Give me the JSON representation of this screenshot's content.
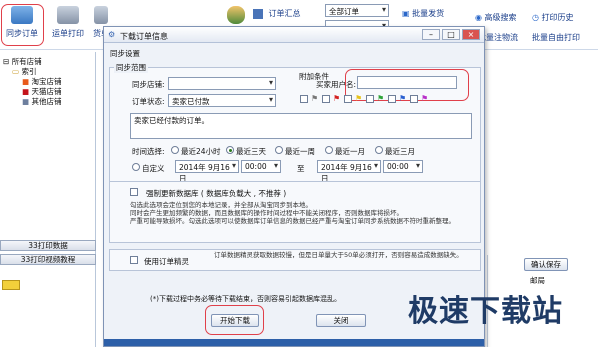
{
  "toolbar": {
    "sync_orders": "同步订单",
    "ship_print": "运单打印",
    "goods": "货单",
    "order_summary": "订单汇总",
    "filter_select": "全部订单",
    "batch_ship": "批量发货",
    "batch_mark": "批量注物流",
    "advanced_search": "高级搜索",
    "print_history": "打印历史",
    "batch_custom_print": "批量自由打印"
  },
  "tree": {
    "all_shops": "所有店铺",
    "index": "索引",
    "taobao": "淘宝店铺",
    "tmall": "天猫店铺",
    "other": "其他店铺"
  },
  "left_buttons": {
    "print_sync": "33打印数据",
    "print_video": "33打印视频教程"
  },
  "dialog": {
    "title": "下载订单信息",
    "sync_settings": "同步设置",
    "sync_range": "同步范围",
    "sync_shop_label": "同步店铺:",
    "order_status_label": "订单状态:",
    "order_status_value": "卖家已付款",
    "extra_cond": "附加条件",
    "buyer_name_label": "买家用户名:",
    "buyer_name_value": "",
    "status_text": "卖家已经付款的订单。",
    "time_label": "时间选择:",
    "time_options": [
      "最近24小时",
      "最近三天",
      "最近一周",
      "最近一月",
      "最近三月"
    ],
    "time_selected_index": 1,
    "custom": "自定义",
    "date_from": "2014年 9月16日",
    "time_from": "00:00",
    "to": "至",
    "date_to": "2014年 9月16日",
    "time_to": "00:00",
    "force_update": "强制更新数据库 ( 数据库负载大 , 不推荐 )",
    "note_lines": [
      "勾选此选项会定位到您的本地记录，并全部从淘宝同步到本地。",
      "同时会产生更加频繁的数据，而且数据库的操作时间过程中不能关闭程序，否则数据库将损坏。",
      "严重可能导致损坏。勾选此选项可以使数据库订单信息的数据已经严重与淘宝订单同步系统数据不符时重新整理。"
    ],
    "use_quick": "使用订单精灵",
    "quick_note": "订单数据精灵获取数据较慢，但是日单量大于50单必须打开，否则容易造成数据缺失。",
    "warning": "(*)下载过程中务必等待下载结束，否则容易引起数据库混乱。",
    "start_button": "开始下载",
    "close_button": "关闭"
  },
  "right_panel": {
    "confirm_save": "确认保存",
    "col_mail": "邮局"
  },
  "watermark": "极速下载站"
}
